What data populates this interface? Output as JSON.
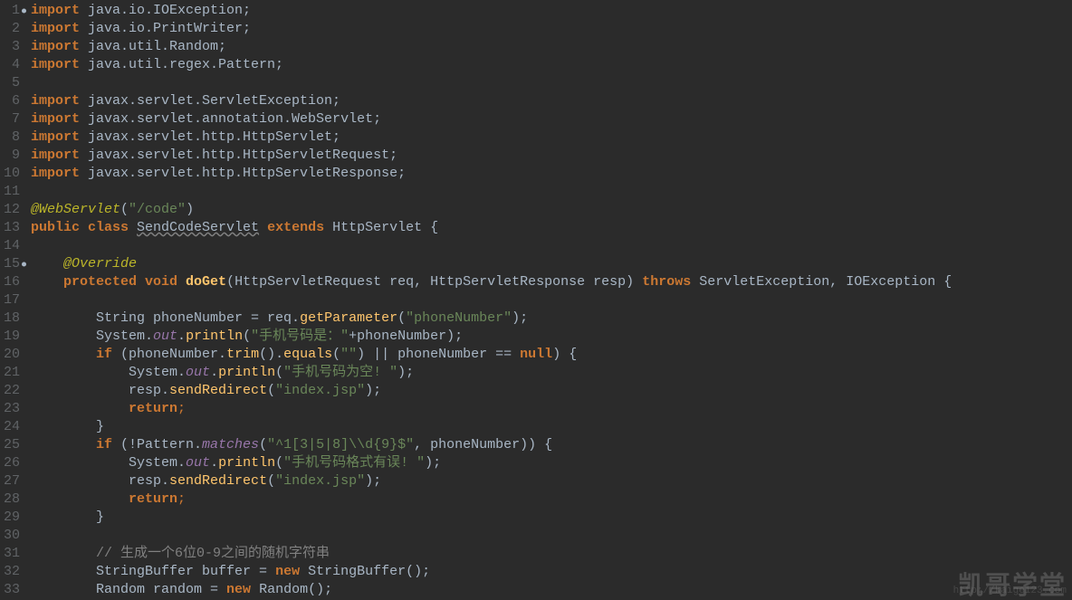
{
  "lines": [
    {
      "n": "1",
      "dot": true,
      "tokens": [
        [
          "kw",
          "import"
        ],
        [
          "",
          " java.io.IOException;"
        ]
      ]
    },
    {
      "n": "2",
      "tokens": [
        [
          "kw",
          "import"
        ],
        [
          "",
          " java.io.PrintWriter;"
        ]
      ]
    },
    {
      "n": "3",
      "tokens": [
        [
          "kw",
          "import"
        ],
        [
          "",
          " java.util.Random;"
        ]
      ]
    },
    {
      "n": "4",
      "tokens": [
        [
          "kw",
          "import"
        ],
        [
          "",
          " java.util.regex.Pattern;"
        ]
      ]
    },
    {
      "n": "5",
      "tokens": []
    },
    {
      "n": "6",
      "tokens": [
        [
          "kw",
          "import"
        ],
        [
          "",
          " javax.servlet.ServletException;"
        ]
      ]
    },
    {
      "n": "7",
      "tokens": [
        [
          "kw",
          "import"
        ],
        [
          "",
          " javax.servlet.annotation.WebServlet;"
        ]
      ]
    },
    {
      "n": "8",
      "tokens": [
        [
          "kw",
          "import"
        ],
        [
          "",
          " javax.servlet.http.HttpServlet;"
        ]
      ]
    },
    {
      "n": "9",
      "tokens": [
        [
          "kw",
          "import"
        ],
        [
          "",
          " javax.servlet.http.HttpServletRequest;"
        ]
      ]
    },
    {
      "n": "10",
      "tokens": [
        [
          "kw",
          "import"
        ],
        [
          "",
          " javax.servlet.http.HttpServletResponse;"
        ]
      ]
    },
    {
      "n": "11",
      "tokens": []
    },
    {
      "n": "12",
      "tokens": [
        [
          "ann",
          "@WebServlet"
        ],
        [
          "",
          "("
        ],
        [
          "str",
          "\"/code\""
        ],
        [
          "",
          ")"
        ]
      ]
    },
    {
      "n": "13",
      "tokens": [
        [
          "kw",
          "public class "
        ],
        [
          "wavy",
          "SendCodeServlet"
        ],
        [
          "kw",
          " extends "
        ],
        [
          "",
          "HttpServlet {"
        ]
      ]
    },
    {
      "n": "14",
      "tokens": []
    },
    {
      "n": "15",
      "dot": true,
      "tokens": [
        [
          "",
          "    "
        ],
        [
          "ann",
          "@Override"
        ]
      ]
    },
    {
      "n": "16",
      "tokens": [
        [
          "",
          "    "
        ],
        [
          "kw",
          "protected void "
        ],
        [
          "mthdef",
          "doGet"
        ],
        [
          "",
          "(HttpServletRequest "
        ],
        [
          "param",
          "req"
        ],
        [
          "",
          ", "
        ],
        [
          "",
          "HttpServletResponse "
        ],
        [
          "param",
          "resp"
        ],
        [
          "",
          ") "
        ],
        [
          "kw",
          "throws "
        ],
        [
          "",
          "ServletException, IOException {"
        ]
      ]
    },
    {
      "n": "17",
      "tokens": []
    },
    {
      "n": "18",
      "tokens": [
        [
          "",
          "        "
        ],
        [
          "",
          "String "
        ],
        [
          "",
          "phoneNumber = req."
        ],
        [
          "mth",
          "getParameter"
        ],
        [
          "",
          "("
        ],
        [
          "str",
          "\"phoneNumber\""
        ],
        [
          "",
          ");"
        ]
      ]
    },
    {
      "n": "19",
      "tokens": [
        [
          "",
          "        "
        ],
        [
          "",
          "System."
        ],
        [
          "fld",
          "out"
        ],
        [
          "",
          "."
        ],
        [
          "mth",
          "println"
        ],
        [
          "",
          "("
        ],
        [
          "str",
          "\"手机号码是：\""
        ],
        [
          "",
          "+phoneNumber);"
        ]
      ]
    },
    {
      "n": "20",
      "tokens": [
        [
          "",
          "        "
        ],
        [
          "kw",
          "if "
        ],
        [
          "",
          "(phoneNumber."
        ],
        [
          "mth",
          "trim"
        ],
        [
          "",
          "()."
        ],
        [
          "mth",
          "equals"
        ],
        [
          "",
          "("
        ],
        [
          "str",
          "\"\""
        ],
        [
          "",
          ") || phoneNumber == "
        ],
        [
          "kw",
          "null"
        ],
        [
          "",
          ") {"
        ]
      ]
    },
    {
      "n": "21",
      "tokens": [
        [
          "",
          "            "
        ],
        [
          "",
          "System."
        ],
        [
          "fld",
          "out"
        ],
        [
          "",
          "."
        ],
        [
          "mth",
          "println"
        ],
        [
          "",
          "("
        ],
        [
          "str",
          "\"手机号码为空! \""
        ],
        [
          "",
          ");"
        ]
      ]
    },
    {
      "n": "22",
      "tokens": [
        [
          "",
          "            "
        ],
        [
          "",
          "resp."
        ],
        [
          "mth",
          "sendRedirect"
        ],
        [
          "",
          "("
        ],
        [
          "str",
          "\"index.jsp\""
        ],
        [
          "",
          ");"
        ]
      ]
    },
    {
      "n": "23",
      "tokens": [
        [
          "",
          "            "
        ],
        [
          "kw",
          "return"
        ],
        [
          "kw2",
          ";"
        ]
      ]
    },
    {
      "n": "24",
      "tokens": [
        [
          "",
          "        }"
        ]
      ]
    },
    {
      "n": "25",
      "tokens": [
        [
          "",
          "        "
        ],
        [
          "kw",
          "if "
        ],
        [
          "",
          "(!Pattern."
        ],
        [
          "fld",
          "matches"
        ],
        [
          "",
          "("
        ],
        [
          "str",
          "\"^1[3|5|8]\\\\d{9}$\""
        ],
        [
          "",
          ", phoneNumber)) {"
        ]
      ]
    },
    {
      "n": "26",
      "tokens": [
        [
          "",
          "            "
        ],
        [
          "",
          "System."
        ],
        [
          "fld",
          "out"
        ],
        [
          "",
          "."
        ],
        [
          "mth",
          "println"
        ],
        [
          "",
          "("
        ],
        [
          "str",
          "\"手机号码格式有误! \""
        ],
        [
          "",
          ");"
        ]
      ]
    },
    {
      "n": "27",
      "tokens": [
        [
          "",
          "            "
        ],
        [
          "",
          "resp."
        ],
        [
          "mth",
          "sendRedirect"
        ],
        [
          "",
          "("
        ],
        [
          "str",
          "\"index.jsp\""
        ],
        [
          "",
          ");"
        ]
      ]
    },
    {
      "n": "28",
      "tokens": [
        [
          "",
          "            "
        ],
        [
          "kw",
          "return"
        ],
        [
          "kw2",
          ";"
        ]
      ]
    },
    {
      "n": "29",
      "tokens": [
        [
          "",
          "        }"
        ]
      ]
    },
    {
      "n": "30",
      "tokens": []
    },
    {
      "n": "31",
      "tokens": [
        [
          "",
          "        "
        ],
        [
          "comm",
          "// 生成一个6位0-9之间的随机字符串"
        ]
      ]
    },
    {
      "n": "32",
      "tokens": [
        [
          "",
          "        "
        ],
        [
          "",
          "StringBuffer "
        ],
        [
          "",
          "buffer = "
        ],
        [
          "kw",
          "new "
        ],
        [
          "",
          "StringBuffer();"
        ]
      ]
    },
    {
      "n": "33",
      "tokens": [
        [
          "",
          "        "
        ],
        [
          "",
          "Random "
        ],
        [
          "",
          "random = "
        ],
        [
          "kw",
          "new "
        ],
        [
          "",
          "Random();"
        ]
      ]
    }
  ],
  "watermark": "凯哥学堂",
  "watermark_url": "http://kaige123.com"
}
